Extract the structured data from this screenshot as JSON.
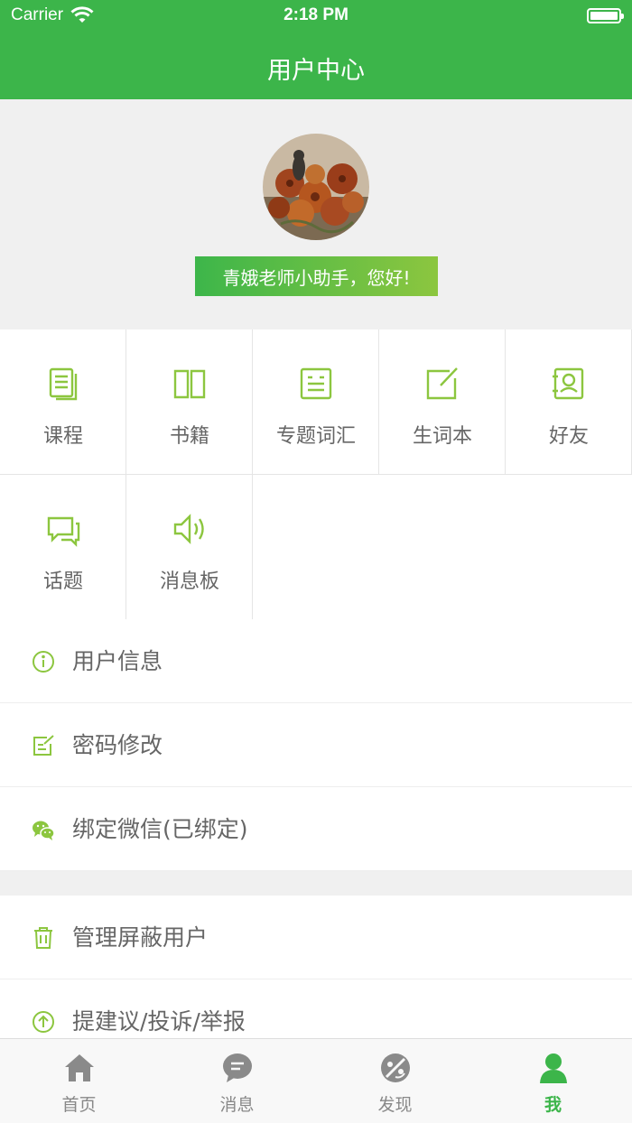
{
  "status_bar": {
    "carrier": "Carrier",
    "time": "2:18 PM"
  },
  "nav": {
    "title": "用户中心"
  },
  "profile": {
    "greeting": "青娥老师小助手，您好!"
  },
  "grid": [
    {
      "label": "课程",
      "icon": "document-icon"
    },
    {
      "label": "书籍",
      "icon": "book-icon"
    },
    {
      "label": "专题词汇",
      "icon": "vocabulary-icon"
    },
    {
      "label": "生词本",
      "icon": "notebook-edit-icon"
    },
    {
      "label": "好友",
      "icon": "contacts-icon"
    },
    {
      "label": "话题",
      "icon": "chat-bubbles-icon"
    },
    {
      "label": "消息板",
      "icon": "speaker-icon"
    }
  ],
  "menu": [
    {
      "label": "用户信息",
      "icon": "info-icon"
    },
    {
      "label": "密码修改",
      "icon": "edit-icon"
    },
    {
      "label": "绑定微信(已绑定)",
      "icon": "wechat-icon"
    },
    {
      "label": "管理屏蔽用户",
      "icon": "trash-icon"
    },
    {
      "label": "提建议/投诉/举报",
      "icon": "upload-circle-icon"
    }
  ],
  "tabs": [
    {
      "label": "首页",
      "icon": "home-icon",
      "active": false
    },
    {
      "label": "消息",
      "icon": "message-icon",
      "active": false
    },
    {
      "label": "发现",
      "icon": "discover-icon",
      "active": false
    },
    {
      "label": "我",
      "icon": "user-icon",
      "active": true
    }
  ],
  "colors": {
    "primary": "#3cb54a",
    "icon_green": "#8cc63f",
    "tab_inactive": "#888888"
  }
}
